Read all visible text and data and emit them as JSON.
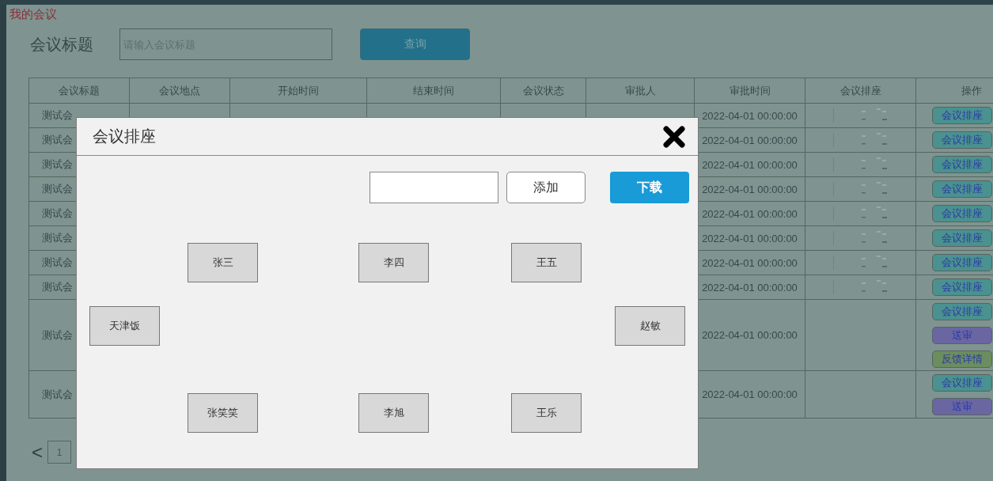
{
  "page_title": "我的会议",
  "search": {
    "label": "会议标题",
    "placeholder": "请输入会议标题",
    "button": "查询"
  },
  "table": {
    "columns": [
      "会议标题",
      "会议地点",
      "开始时间",
      "结束时间",
      "会议状态",
      "审批人",
      "审批时间",
      "会议排座",
      "操作"
    ],
    "rows": [
      {
        "title": "测试会",
        "approved_at": "2022-04-01 00:00:00",
        "seating_preview": true,
        "actions": [
          {
            "label": "会议排座",
            "kind": "seat"
          }
        ]
      },
      {
        "title": "测试会",
        "approved_at": "2022-04-01 00:00:00",
        "seating_preview": true,
        "actions": [
          {
            "label": "会议排座",
            "kind": "seat"
          }
        ]
      },
      {
        "title": "测试会",
        "approved_at": "2022-04-01 00:00:00",
        "seating_preview": true,
        "actions": [
          {
            "label": "会议排座",
            "kind": "seat"
          }
        ]
      },
      {
        "title": "测试会",
        "approved_at": "2022-04-01 00:00:00",
        "seating_preview": true,
        "actions": [
          {
            "label": "会议排座",
            "kind": "seat"
          }
        ]
      },
      {
        "title": "测试会",
        "approved_at": "2022-04-01 00:00:00",
        "seating_preview": true,
        "actions": [
          {
            "label": "会议排座",
            "kind": "seat"
          }
        ]
      },
      {
        "title": "测试会",
        "approved_at": "2022-04-01 00:00:00",
        "seating_preview": true,
        "actions": [
          {
            "label": "会议排座",
            "kind": "seat"
          }
        ]
      },
      {
        "title": "测试会",
        "approved_at": "2022-04-01 00:00:00",
        "seating_preview": true,
        "actions": [
          {
            "label": "会议排座",
            "kind": "seat"
          }
        ]
      },
      {
        "title": "测试会",
        "approved_at": "2022-04-01 00:00:00",
        "seating_preview": true,
        "actions": [
          {
            "label": "会议排座",
            "kind": "seat"
          }
        ]
      },
      {
        "title": "测试会",
        "approved_at": "2022-04-01 00:00:00",
        "seating_preview": false,
        "actions": [
          {
            "label": "会议排座",
            "kind": "seat"
          },
          {
            "label": "送审",
            "kind": "submit"
          },
          {
            "label": "反馈详情",
            "kind": "feedback"
          }
        ]
      },
      {
        "title": "测试会",
        "approved_at": "2022-04-01 00:00:00",
        "seating_preview": false,
        "actions": [
          {
            "label": "会议排座",
            "kind": "seat"
          },
          {
            "label": "送审",
            "kind": "submit"
          }
        ]
      }
    ]
  },
  "pagination": {
    "prev": "<",
    "pages": [
      "1"
    ]
  },
  "dialog": {
    "title": "会议排座",
    "add_button": "添加",
    "download_button": "下载",
    "seats": {
      "top": [
        "张三",
        "李四",
        "王五"
      ],
      "left": [
        "天津饭"
      ],
      "right": [
        "赵敏"
      ],
      "bottom": [
        "张笑笑",
        "李旭",
        "王乐"
      ]
    }
  }
}
